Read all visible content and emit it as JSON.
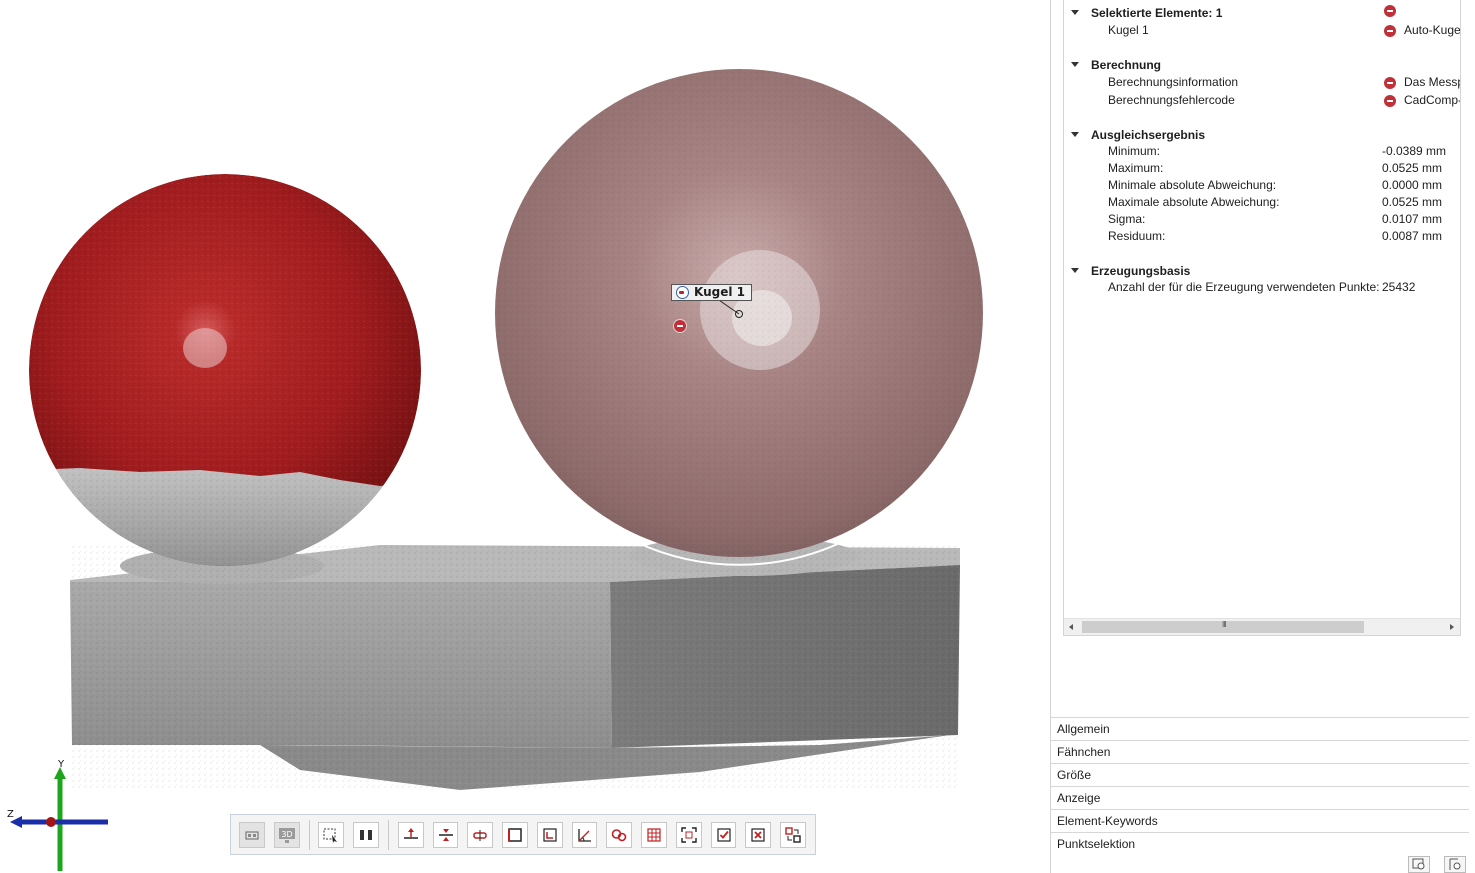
{
  "viewport": {
    "label_tag": "Kugel 1",
    "axis_labels": {
      "y": "Y",
      "z": "Z"
    },
    "colors": {
      "red_sphere": "#a21d1f",
      "selected_sphere": "#9b7676",
      "mesh_gray": "#9c9c9c",
      "axis_y": "#1ea51e",
      "axis_x": "#1a2ea8",
      "error_badge": "#c03038"
    }
  },
  "toolbar": {
    "buttons": [
      {
        "icon": "view-2d-icon"
      },
      {
        "icon": "view-3d-icon",
        "label": "3D"
      },
      {
        "icon": "select-rectangle-icon"
      },
      {
        "icon": "align-bars-icon"
      },
      {
        "icon": "plane-horizontal-icon"
      },
      {
        "icon": "plane-vertical-icon"
      },
      {
        "icon": "slot-icon"
      },
      {
        "icon": "square-icon"
      },
      {
        "icon": "rectangle-corner-icon"
      },
      {
        "icon": "angle-icon"
      },
      {
        "icon": "circles-icon"
      },
      {
        "icon": "grid-icon"
      },
      {
        "icon": "fit-frame-icon"
      },
      {
        "icon": "accept-icon"
      },
      {
        "icon": "reject-icon"
      },
      {
        "icon": "transform-icon"
      }
    ]
  },
  "tree": {
    "selection": {
      "title": "Selektierte Elemente: 1",
      "item_name": "Kugel 1",
      "item_value": "Auto-Kuge"
    },
    "calculation": {
      "title": "Berechnung",
      "rows": [
        {
          "key": "Berechnungsinformation",
          "value": "Das Messp"
        },
        {
          "key": "Berechnungsfehlercode",
          "value": "CadComp-"
        }
      ]
    },
    "fit_result": {
      "title": "Ausgleichsergebnis",
      "rows": [
        {
          "key": "Minimum:",
          "value": "-0.0389 mm"
        },
        {
          "key": "Maximum:",
          "value": "0.0525 mm"
        },
        {
          "key": "Minimale absolute Abweichung:",
          "value": "0.0000 mm"
        },
        {
          "key": "Maximale absolute Abweichung:",
          "value": "0.0525 mm"
        },
        {
          "key": "Sigma:",
          "value": "0.0107 mm"
        },
        {
          "key": "Residuum:",
          "value": "0.0087 mm"
        }
      ]
    },
    "creation_basis": {
      "title": "Erzeugungsbasis",
      "rows": [
        {
          "key": "Anzahl der für die Erzeugung verwendeten Punkte:",
          "value": "25432"
        }
      ]
    },
    "scrollbar_grip": "III"
  },
  "property_tabs": [
    "Allgemein",
    "Fähnchen",
    "Größe",
    "Anzeige",
    "Element-Keywords",
    "Punktselektion"
  ]
}
